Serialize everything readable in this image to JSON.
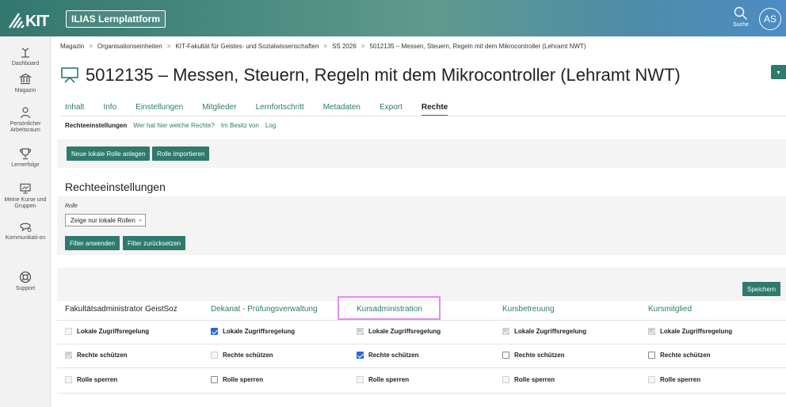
{
  "header": {
    "logo": "KIT",
    "app_title": "ILIAS Lernplattform",
    "search_label": "Suche",
    "avatar_initials": "AS"
  },
  "sidebar": {
    "items": [
      {
        "label": "Dashboard",
        "icon": "dashboard-icon"
      },
      {
        "label": "Magazin",
        "icon": "library-icon"
      },
      {
        "label": "Persönlicher Arbeitsraum",
        "icon": "person-icon"
      },
      {
        "label": "Lernerfolge",
        "icon": "trophy-icon"
      },
      {
        "label": "Meine Kurse und Gruppen",
        "icon": "monitor-icon"
      },
      {
        "label": "Kommunikati-on",
        "icon": "chat-icon"
      },
      {
        "label": "Support",
        "icon": "lifebuoy-icon"
      }
    ]
  },
  "breadcrumb": [
    "Magazin",
    "Organisationseinheiten",
    "KIT-Fakultät für Geistes- und Sozialwissenschaften",
    "SS 2026",
    "5012135 – Messen, Steuern, Regeln mit dem Mikrocontroller (Lehramt NWT)"
  ],
  "page_title": "5012135 – Messen, Steuern, Regeln mit dem Mikrocontroller (Lehramt NWT)",
  "tabs": [
    "Inhalt",
    "Info",
    "Einstellungen",
    "Mitglieder",
    "Lernfortschritt",
    "Metadaten",
    "Export",
    "Rechte"
  ],
  "active_tab": "Rechte",
  "subtabs": [
    "Rechteeinstellungen",
    "Wer hat hier welche Rechte?",
    "Im Besitz von",
    "Log"
  ],
  "toolbar": {
    "new_role": "Neue lokale Rolle anlegen",
    "import_role": "Rolle importieren"
  },
  "section_title": "Rechteeinstellungen",
  "filter": {
    "label": "Rolle",
    "selected": "Zeige nur lokale Rollen",
    "apply": "Filter anwenden",
    "reset": "Filter zurücksetzen"
  },
  "save_label": "Speichern",
  "columns": [
    {
      "name": "Fakultätsadministrator GeistSoz",
      "link": false,
      "perms": [
        {
          "checked": false,
          "disabled": true
        },
        {
          "checked": true,
          "disabled": true
        },
        {
          "checked": false,
          "disabled": true
        }
      ]
    },
    {
      "name": "Dekanat - Prüfungsverwaltung",
      "link": true,
      "perms": [
        {
          "checked": true,
          "disabled": false
        },
        {
          "checked": false,
          "disabled": true
        },
        {
          "checked": false,
          "disabled": false
        }
      ]
    },
    {
      "name": "Kursadministration",
      "link": true,
      "perms": [
        {
          "checked": true,
          "disabled": true
        },
        {
          "checked": true,
          "disabled": false
        },
        {
          "checked": false,
          "disabled": true
        }
      ]
    },
    {
      "name": "Kursbetreuung",
      "link": true,
      "perms": [
        {
          "checked": true,
          "disabled": true
        },
        {
          "checked": false,
          "disabled": false
        },
        {
          "checked": false,
          "disabled": true
        }
      ]
    },
    {
      "name": "Kursmitglied",
      "link": true,
      "perms": [
        {
          "checked": true,
          "disabled": true
        },
        {
          "checked": false,
          "disabled": false
        },
        {
          "checked": false,
          "disabled": true
        }
      ]
    }
  ],
  "perm_labels": [
    "Lokale Zugriffsregelung",
    "Rechte schützen",
    "Rolle sperren"
  ],
  "colors": {
    "accent": "#2e7a6c",
    "highlight": "#e58bf0",
    "check": "#2a6ad6"
  }
}
